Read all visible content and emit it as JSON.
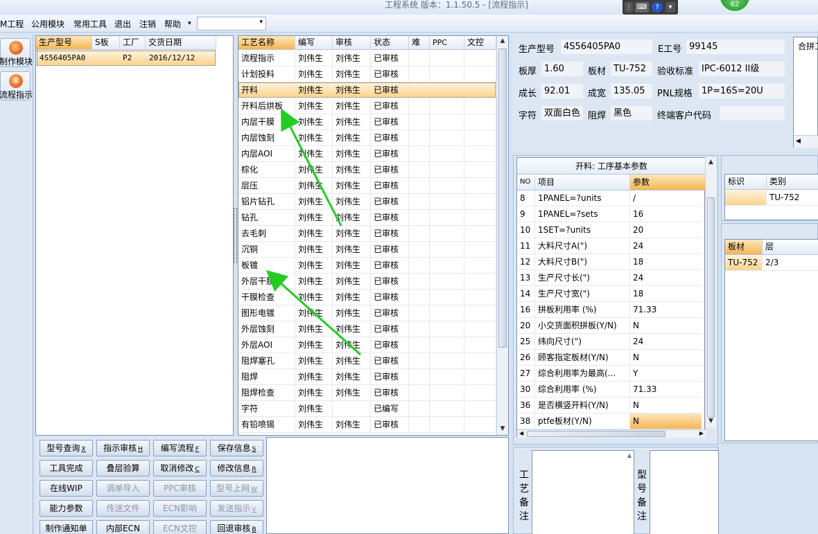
{
  "window": {
    "title": "工程系统   版本：1.1.50.5 - [流程指示]",
    "badge_count": "62"
  },
  "menu": {
    "items": [
      "M工程",
      "公用模块",
      "常用工具",
      "退出",
      "注销",
      "帮助"
    ],
    "help_arrow": "▾",
    "combo_value": ""
  },
  "left_strip": {
    "buttons": [
      {
        "label": "制作模块",
        "icon": "flame-icon"
      },
      {
        "label": "流程指示",
        "icon": "flow-icon"
      }
    ]
  },
  "model_list": {
    "headers": [
      "生产型号",
      "S板",
      "工厂",
      "交货日期"
    ],
    "rows": [
      {
        "model": "4S56405PA0",
        "s_board": "",
        "factory": "P2",
        "date": "2016/12/12"
      }
    ]
  },
  "process_list": {
    "headers": [
      "工艺名称",
      "编写",
      "审核",
      "状态",
      "难",
      "PPC",
      "文控"
    ],
    "selected_index": 2,
    "rows": [
      {
        "name": "流程指示",
        "writer": "刘伟生",
        "reviewer": "刘伟生",
        "status": "已审核"
      },
      {
        "name": "计划投料",
        "writer": "刘伟生",
        "reviewer": "刘伟生",
        "status": "已审核"
      },
      {
        "name": "开料",
        "writer": "刘伟生",
        "reviewer": "刘伟生",
        "status": "已审核"
      },
      {
        "name": "开料后烘板",
        "writer": "刘伟生",
        "reviewer": "刘伟生",
        "status": "已审核"
      },
      {
        "name": "内层干膜",
        "writer": "刘伟生",
        "reviewer": "刘伟生",
        "status": "已审核"
      },
      {
        "name": "内层蚀刻",
        "writer": "刘伟生",
        "reviewer": "刘伟生",
        "status": "已审核"
      },
      {
        "name": "内层AOI",
        "writer": "刘伟生",
        "reviewer": "刘伟生",
        "status": "已审核"
      },
      {
        "name": "棕化",
        "writer": "刘伟生",
        "reviewer": "刘伟生",
        "status": "已审核"
      },
      {
        "name": "层压",
        "writer": "刘伟生",
        "reviewer": "刘伟生",
        "status": "已审核"
      },
      {
        "name": "铝片钻孔",
        "writer": "刘伟生",
        "reviewer": "刘伟生",
        "status": "已审核"
      },
      {
        "name": "钻孔",
        "writer": "刘伟生",
        "reviewer": "刘伟生",
        "status": "已审核"
      },
      {
        "name": "去毛刺",
        "writer": "刘伟生",
        "reviewer": "刘伟生",
        "status": "已审核"
      },
      {
        "name": "沉铜",
        "writer": "刘伟生",
        "reviewer": "刘伟生",
        "status": "已审核"
      },
      {
        "name": "板镀",
        "writer": "刘伟生",
        "reviewer": "刘伟生",
        "status": "已审核"
      },
      {
        "name": "外层干膜",
        "writer": "刘伟生",
        "reviewer": "刘伟生",
        "status": "已审核"
      },
      {
        "name": "干膜检查",
        "writer": "刘伟生",
        "reviewer": "刘伟生",
        "status": "已审核"
      },
      {
        "name": "图形电镀",
        "writer": "刘伟生",
        "reviewer": "刘伟生",
        "status": "已审核"
      },
      {
        "name": "外层蚀刻",
        "writer": "刘伟生",
        "reviewer": "刘伟生",
        "status": "已审核"
      },
      {
        "name": "外层AOI",
        "writer": "刘伟生",
        "reviewer": "刘伟生",
        "status": "已审核"
      },
      {
        "name": "阻焊塞孔",
        "writer": "刘伟生",
        "reviewer": "刘伟生",
        "status": "已审核"
      },
      {
        "name": "阻焊",
        "writer": "刘伟生",
        "reviewer": "刘伟生",
        "status": "已审核"
      },
      {
        "name": "阻焊检查",
        "writer": "刘伟生",
        "reviewer": "刘伟生",
        "status": "已审核"
      },
      {
        "name": "字符",
        "writer": "刘伟生",
        "reviewer": "",
        "status": "已编写"
      },
      {
        "name": "有铅喷锡",
        "writer": "刘伟生",
        "reviewer": "刘伟生",
        "status": "已审核"
      }
    ]
  },
  "buttons": [
    {
      "label": "型号查询",
      "key": "X",
      "enabled": true
    },
    {
      "label": "指示审核",
      "key": "H",
      "enabled": true
    },
    {
      "label": "编写流程",
      "key": "F",
      "enabled": true
    },
    {
      "label": "保存信息",
      "key": "S",
      "enabled": true
    },
    {
      "label": "工具完成",
      "key": "",
      "enabled": true
    },
    {
      "label": "叠层验算",
      "key": "",
      "enabled": true
    },
    {
      "label": "取消修改",
      "key": "C",
      "enabled": true
    },
    {
      "label": "修改信息",
      "key": "R",
      "enabled": true
    },
    {
      "label": "在线WIP",
      "key": "",
      "enabled": true
    },
    {
      "label": "调单导入",
      "key": "",
      "enabled": false
    },
    {
      "label": "PPC审核",
      "key": "",
      "enabled": false
    },
    {
      "label": "型号上网",
      "key": "W",
      "enabled": false
    },
    {
      "label": "能力参数",
      "key": "",
      "enabled": true
    },
    {
      "label": "传送文件",
      "key": "",
      "enabled": false
    },
    {
      "label": "ECN影响",
      "key": "",
      "enabled": false
    },
    {
      "label": "发送指示",
      "key": "V",
      "enabled": false
    },
    {
      "label": "制作通知单",
      "key": "",
      "enabled": true
    },
    {
      "label": "内部ECN",
      "key": "",
      "enabled": true
    },
    {
      "label": "ECN文控",
      "key": "",
      "enabled": false
    },
    {
      "label": "回退审核",
      "key": "B",
      "enabled": true
    }
  ],
  "info": {
    "model_label": "生产型号",
    "model_value": "4S56405PA0",
    "e_no_label": "E工号",
    "e_no_value": "99145",
    "thickness_label": "板厚",
    "thickness_value": "1.60",
    "material_label": "板材",
    "material_value": "TU-752",
    "standard_label": "验收标准",
    "standard_value": "IPC-6012 II级",
    "length_label": "成长",
    "length_value": "92.01",
    "width_label": "成宽",
    "width_value": "135.05",
    "pnl_label": "PNL规格",
    "pnl_value": "1P=16S=20U",
    "char_label": "字符",
    "char_value": "双面白色",
    "mask_label": "阻焊",
    "mask_value": "黑色",
    "customer_label": "终端客户代码",
    "customer_value": "",
    "panel_tab": "合拼工"
  },
  "params": {
    "title": "开料: 工序基本参数",
    "headers": [
      "NO",
      "项目",
      "参数"
    ],
    "selected_no": "38",
    "rows": [
      {
        "no": "8",
        "item": "1PANEL=?units",
        "value": "/"
      },
      {
        "no": "9",
        "item": "1PANEL=?sets",
        "value": "16"
      },
      {
        "no": "10",
        "item": "1SET=?units",
        "value": "20"
      },
      {
        "no": "11",
        "item": "大料尺寸A(\")",
        "value": "24"
      },
      {
        "no": "12",
        "item": "大料尺寸B(\")",
        "value": "18"
      },
      {
        "no": "13",
        "item": "生产尺寸长(\")",
        "value": "24"
      },
      {
        "no": "14",
        "item": "生产尺寸宽(\")",
        "value": "18"
      },
      {
        "no": "16",
        "item": "拼板利用率 (%)",
        "value": "71.33"
      },
      {
        "no": "20",
        "item": "小交货面积拼板(Y/N)",
        "value": "N"
      },
      {
        "no": "25",
        "item": "纬向尺寸(\")",
        "value": "24"
      },
      {
        "no": "26",
        "item": "顾客指定板材(Y/N)",
        "value": "N"
      },
      {
        "no": "27",
        "item": "综合利用率为最高(...",
        "value": "Y"
      },
      {
        "no": "30",
        "item": "综合利用率 (%)",
        "value": "71.33"
      },
      {
        "no": "36",
        "item": "是否横竖开料(Y/N)",
        "value": "N"
      },
      {
        "no": "38",
        "item": "ptfe板材(Y/N)",
        "value": "N"
      }
    ]
  },
  "tag_table": {
    "headers": [
      "标识",
      "类别"
    ],
    "rows": [
      {
        "tag": "",
        "category": "TU-752"
      }
    ]
  },
  "layer_table": {
    "headers": [
      "板材",
      "层"
    ],
    "rows": [
      {
        "material": "TU-752",
        "layer": "2/3"
      }
    ]
  },
  "notes": {
    "process_label": "工艺备注",
    "model_label": "型号备注"
  },
  "annotations": {
    "arrow_color": "#22cc22"
  }
}
